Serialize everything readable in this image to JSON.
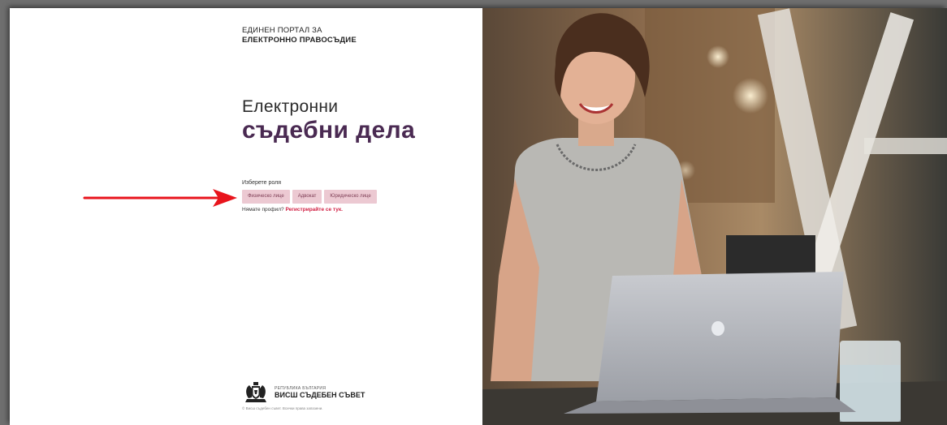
{
  "portal": {
    "line1": "ЕДИНЕН ПОРТАЛ ЗА",
    "line2": "ЕЛЕКТРОННО ПРАВОСЪДИЕ"
  },
  "hero": {
    "line1": "Електронни",
    "line2": "съдебни дела"
  },
  "roles": {
    "label": "Изберете роля",
    "items": [
      "Физическо лице",
      "Адвокат",
      "Юридическо лице"
    ]
  },
  "register": {
    "prompt": "Нямате профил?",
    "link": "Регистрирайте се тук."
  },
  "footer": {
    "small": "РЕПУБЛИКА БЪЛГАРИЯ",
    "big": "ВИСШ СЪДЕБЕН СЪВЕТ",
    "copyright": "© Висш съдебен съвет. Всички права запазени."
  },
  "colors": {
    "accent": "#4a2a52",
    "button_bg": "#ecc9d2",
    "link": "#d11e42",
    "arrow": "#e8141c"
  }
}
